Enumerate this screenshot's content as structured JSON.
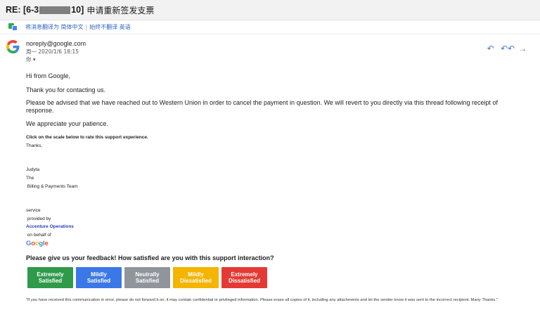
{
  "subject": {
    "prefix": "RE: [6-3",
    "suffix": "10]",
    "chinese": "申请重新签发支票"
  },
  "translate": {
    "text": "将消息翻译为 简体中文",
    "sep": "|",
    "never": "始终不翻译 英语"
  },
  "sender": {
    "email": "noreply@google.com",
    "date": "周一 2020/1/6 18:15",
    "to": "你 ▾"
  },
  "actions": {
    "reply": "↶",
    "reply_all": "↶↶",
    "forward": "→"
  },
  "body": {
    "greeting": "Hi from Google,",
    "thanks": "Thank you for contacting us.",
    "advised": "Please be advised that we have reached out to Western Union in order to cancel the payment in question. We will revert to you directly via this thread following receipt of response.",
    "appreciate": "We appreciate your patience.",
    "rate_prompt": "Click on the scale below to rate this support experience.",
    "thanks2": "Thanks,",
    "sig_name": "Judyta",
    "sig_the": "The",
    "sig_team": " Billing & Payments Team",
    "service": "service",
    "provided_by": " provided by",
    "accenture": "Accenture Operations",
    "on_behalf": " on behalf of",
    "google": [
      "G",
      "o",
      "o",
      "g",
      "l",
      "e"
    ]
  },
  "feedback": {
    "question": "Please give us your feedback! How satisfied are you with this support interaction?"
  },
  "ratings": [
    {
      "line1": "Extremely",
      "line2": "Satisfied",
      "color": "#2e9a4a"
    },
    {
      "line1": "Mildly",
      "line2": "Satisfied",
      "color": "#3b78e7"
    },
    {
      "line1": "Neutrally",
      "line2": "Satisfied",
      "color": "#8f959b"
    },
    {
      "line1": "Mildly",
      "line2": "Dissatisfied",
      "color": "#f4b400"
    },
    {
      "line1": "Extremely",
      "line2": "Dissatisfied",
      "color": "#e53935"
    }
  ],
  "disclaimer": "\"If you have received this communication in error, please do not forward it on; it may contain confidential or privileged information. Please erase all copies of it, including any attachments and let the sender know it was sent to the incorrect recipient. Many Thanks.\"",
  "colors": {
    "google_blue": "#4285f4",
    "google_red": "#ea4335",
    "google_yellow": "#fbbc05",
    "google_green": "#34a853"
  }
}
